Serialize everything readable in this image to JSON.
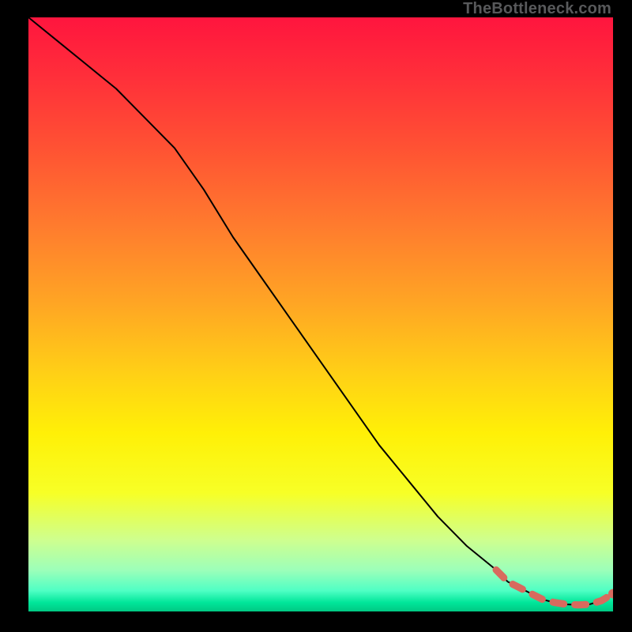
{
  "watermark": "TheBottleneck.com",
  "gradient": {
    "stops": [
      {
        "offset": 0.0,
        "color": "#ff153e"
      },
      {
        "offset": 0.1,
        "color": "#ff2f3a"
      },
      {
        "offset": 0.22,
        "color": "#ff5233"
      },
      {
        "offset": 0.35,
        "color": "#ff7b2e"
      },
      {
        "offset": 0.48,
        "color": "#ffa524"
      },
      {
        "offset": 0.6,
        "color": "#ffd016"
      },
      {
        "offset": 0.7,
        "color": "#fff007"
      },
      {
        "offset": 0.8,
        "color": "#f7ff26"
      },
      {
        "offset": 0.88,
        "color": "#ceff8f"
      },
      {
        "offset": 0.93,
        "color": "#9dffb9"
      },
      {
        "offset": 0.965,
        "color": "#4fffc4"
      },
      {
        "offset": 0.985,
        "color": "#00e699"
      },
      {
        "offset": 1.0,
        "color": "#00c883"
      }
    ]
  },
  "chart_data": {
    "type": "line",
    "title": "",
    "xlabel": "",
    "ylabel": "",
    "xlim": [
      0,
      100
    ],
    "ylim": [
      0,
      100
    ],
    "series": [
      {
        "name": "main-curve",
        "x": [
          0,
          5,
          10,
          15,
          20,
          25,
          30,
          35,
          40,
          45,
          50,
          55,
          60,
          65,
          70,
          75,
          80,
          82,
          84,
          86,
          88,
          90,
          92,
          94,
          96,
          98,
          100
        ],
        "values": [
          100,
          96,
          92,
          88,
          83,
          78,
          71,
          63,
          56,
          49,
          42,
          35,
          28,
          22,
          16,
          11,
          7,
          5,
          4,
          3,
          2,
          1.5,
          1.2,
          1.1,
          1.2,
          1.8,
          3
        ]
      }
    ],
    "highlight_segment": {
      "name": "dashed-highlight",
      "color": "#d86a5e",
      "x": [
        80,
        82,
        84,
        86,
        88,
        90,
        92,
        94,
        96,
        98,
        100
      ],
      "values": [
        7,
        5,
        4,
        3,
        2,
        1.5,
        1.2,
        1.1,
        1.2,
        1.8,
        3
      ]
    },
    "end_marker": {
      "x": 100,
      "value": 3,
      "color": "#d86a5e"
    }
  }
}
